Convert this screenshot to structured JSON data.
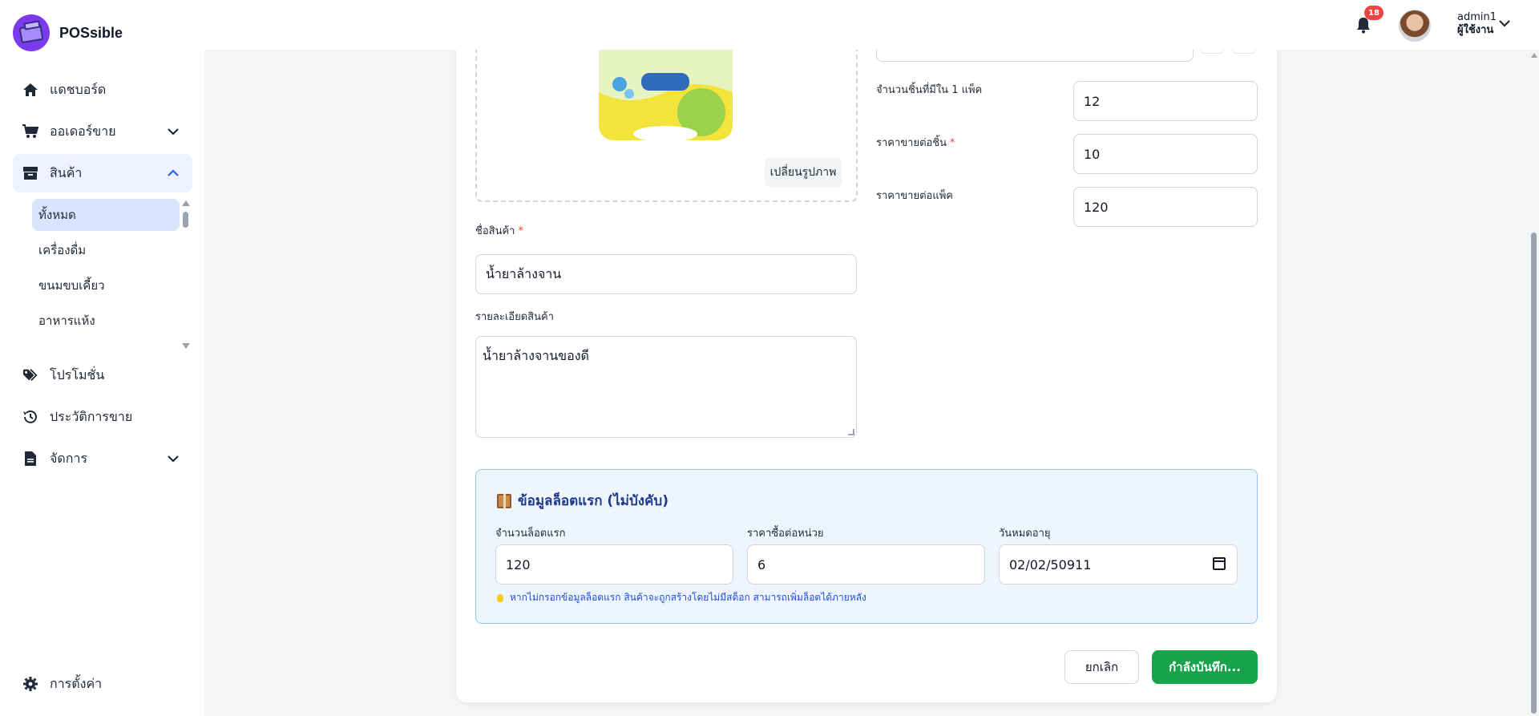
{
  "app": {
    "name": "POSsible"
  },
  "sidebar": {
    "items": [
      {
        "label": "แดชบอร์ด",
        "icon": "home-icon"
      },
      {
        "label": "ออเดอร์ขาย",
        "icon": "cart-icon"
      },
      {
        "label": "สินค้า",
        "icon": "box-icon"
      },
      {
        "label": "โปรโมชั่น",
        "icon": "tags-icon"
      },
      {
        "label": "ประวัติการขาย",
        "icon": "history-icon"
      },
      {
        "label": "จัดการ",
        "icon": "document-icon"
      }
    ],
    "subitems": [
      "ทั้งหมด",
      "เครื่องดื่ม",
      "ขนมขบเคี้ยว",
      "อาหารแห้ง"
    ],
    "settings_label": "การตั้งค่า"
  },
  "header": {
    "notification_count": "18",
    "user_name": "admin1",
    "user_role": "ผู้ใช้งาน"
  },
  "form": {
    "change_image_label": "เปลี่ยนรูปภาพ",
    "product_name_label": "ชื่อสินค้า",
    "product_name_value": "น้ำยาล้างจาน",
    "description_label": "รายละเอียดสินค้า",
    "description_value": "น้ำยาล้างจานของดี",
    "pieces_per_pack_label": "จำนวนชิ้นที่มีใน 1 แพ็ค",
    "pieces_per_pack_value": "12",
    "price_per_piece_label": "ราคาขายต่อชิ้น",
    "price_per_piece_value": "10",
    "price_per_pack_label": "ราคาขายต่อแพ็ค",
    "price_per_pack_value": "120",
    "required_mark": "*"
  },
  "lot": {
    "title": "ข้อมูลล็อตแรก (ไม่บังคับ)",
    "qty_label": "จำนวนล็อตแรก",
    "qty_value": "120",
    "cost_label": "ราคาซื้อต่อหน่วย",
    "cost_value": "6",
    "expiry_label": "วันหมดอายุ",
    "expiry_value": "02/02/50911",
    "hint": "หากไม่กรอกข้อมูลล็อตแรก สินค้าจะถูกสร้างโดยไม่มีสต็อก สามารถเพิ่มล็อตได้ภายหลัง"
  },
  "actions": {
    "cancel_label": "ยกเลิก",
    "save_label": "กำลังบันทึก..."
  },
  "colors": {
    "accent": "#2563eb",
    "save": "#16a34a",
    "badge": "#ef4444",
    "lot_bg": "#eef5ff",
    "lot_border": "#93c5fd"
  }
}
